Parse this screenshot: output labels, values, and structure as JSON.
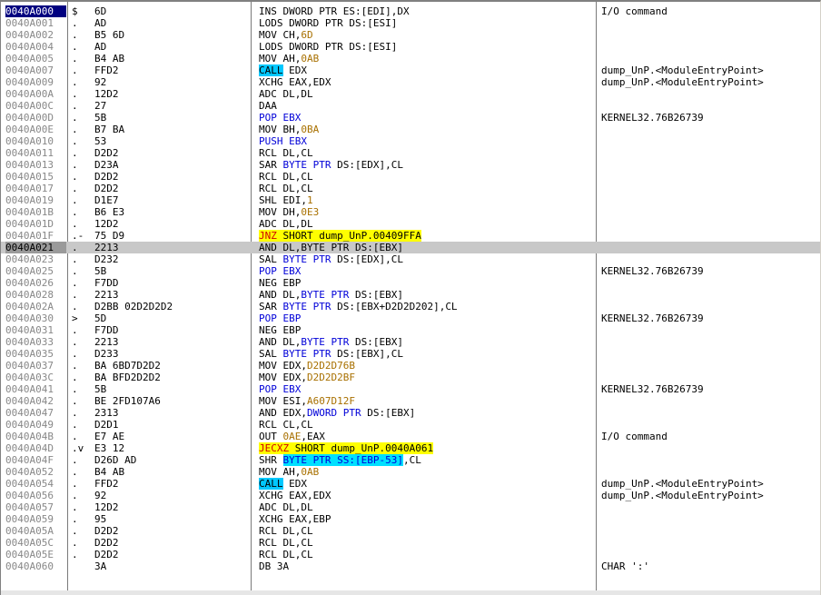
{
  "rows": [
    {
      "addr": "0040A000",
      "mark": "$",
      "hex": "6D",
      "asm": [
        {
          "t": "INS DWORD PTR ES:[EDI],DX",
          "c": "p"
        }
      ],
      "cmt": "I/O command",
      "first": true
    },
    {
      "addr": "0040A001",
      "mark": ".",
      "hex": "AD",
      "asm": [
        {
          "t": "LODS DWORD PTR DS:[ESI]",
          "c": "p"
        }
      ],
      "cmt": ""
    },
    {
      "addr": "0040A002",
      "mark": ".",
      "hex": "B5 6D",
      "asm": [
        {
          "t": "MOV CH,",
          "c": "p"
        },
        {
          "t": "6D",
          "c": "n"
        }
      ],
      "cmt": ""
    },
    {
      "addr": "0040A004",
      "mark": ".",
      "hex": "AD",
      "asm": [
        {
          "t": "LODS DWORD PTR DS:[ESI]",
          "c": "p"
        }
      ],
      "cmt": ""
    },
    {
      "addr": "0040A005",
      "mark": ".",
      "hex": "B4 AB",
      "asm": [
        {
          "t": "MOV AH,",
          "c": "p"
        },
        {
          "t": "0AB",
          "c": "n"
        }
      ],
      "cmt": ""
    },
    {
      "addr": "0040A007",
      "mark": ".",
      "hex": "FFD2",
      "asm": [
        {
          "t": "CALL",
          "c": "call"
        },
        {
          "t": " EDX",
          "c": "p"
        }
      ],
      "cmt": "dump_UnP.<ModuleEntryPoint>"
    },
    {
      "addr": "0040A009",
      "mark": ".",
      "hex": "92",
      "asm": [
        {
          "t": "XCHG EAX,EDX",
          "c": "p"
        }
      ],
      "cmt": "dump_UnP.<ModuleEntryPoint>"
    },
    {
      "addr": "0040A00A",
      "mark": ".",
      "hex": "12D2",
      "asm": [
        {
          "t": "ADC DL,DL",
          "c": "p"
        }
      ],
      "cmt": ""
    },
    {
      "addr": "0040A00C",
      "mark": ".",
      "hex": "27",
      "asm": [
        {
          "t": "DAA",
          "c": "p"
        }
      ],
      "cmt": ""
    },
    {
      "addr": "0040A00D",
      "mark": ".",
      "hex": "5B",
      "asm": [
        {
          "t": "POP EBX",
          "c": "b"
        }
      ],
      "cmt": "KERNEL32.76B26739"
    },
    {
      "addr": "0040A00E",
      "mark": ".",
      "hex": "B7 BA",
      "asm": [
        {
          "t": "MOV BH,",
          "c": "p"
        },
        {
          "t": "0BA",
          "c": "n"
        }
      ],
      "cmt": ""
    },
    {
      "addr": "0040A010",
      "mark": ".",
      "hex": "53",
      "asm": [
        {
          "t": "PUSH EBX",
          "c": "b"
        }
      ],
      "cmt": ""
    },
    {
      "addr": "0040A011",
      "mark": ".",
      "hex": "D2D2",
      "asm": [
        {
          "t": "RCL DL,CL",
          "c": "p"
        }
      ],
      "cmt": ""
    },
    {
      "addr": "0040A013",
      "mark": ".",
      "hex": "D23A",
      "asm": [
        {
          "t": "SAR ",
          "c": "p"
        },
        {
          "t": "BYTE PTR",
          "c": "b"
        },
        {
          "t": " DS:[EDX],CL",
          "c": "p"
        }
      ],
      "cmt": ""
    },
    {
      "addr": "0040A015",
      "mark": ".",
      "hex": "D2D2",
      "asm": [
        {
          "t": "RCL DL,CL",
          "c": "p"
        }
      ],
      "cmt": ""
    },
    {
      "addr": "0040A017",
      "mark": ".",
      "hex": "D2D2",
      "asm": [
        {
          "t": "RCL DL,CL",
          "c": "p"
        }
      ],
      "cmt": ""
    },
    {
      "addr": "0040A019",
      "mark": ".",
      "hex": "D1E7",
      "asm": [
        {
          "t": "SHL EDI,",
          "c": "p"
        },
        {
          "t": "1",
          "c": "n"
        }
      ],
      "cmt": ""
    },
    {
      "addr": "0040A01B",
      "mark": ".",
      "hex": "B6 E3",
      "asm": [
        {
          "t": "MOV DH,",
          "c": "p"
        },
        {
          "t": "0E3",
          "c": "n"
        }
      ],
      "cmt": ""
    },
    {
      "addr": "0040A01D",
      "mark": ".",
      "hex": "12D2",
      "asm": [
        {
          "t": "ADC DL,DL",
          "c": "p"
        }
      ],
      "cmt": ""
    },
    {
      "addr": "0040A01F",
      "mark": ".-",
      "hex": "75 D9",
      "asm": [
        {
          "t": "JNZ",
          "c": "jmp"
        },
        {
          "t": " SHORT dump_UnP.00409FFA",
          "c": "jt"
        }
      ],
      "cmt": ""
    },
    {
      "addr": "0040A021",
      "mark": ".",
      "hex": "2213",
      "asm": [
        {
          "t": "AND DL,BYTE PTR DS:[EBX]",
          "c": "p"
        }
      ],
      "cmt": "",
      "sel": true
    },
    {
      "addr": "0040A023",
      "mark": ".",
      "hex": "D232",
      "asm": [
        {
          "t": "SAL ",
          "c": "p"
        },
        {
          "t": "BYTE PTR",
          "c": "b"
        },
        {
          "t": " DS:[EDX],CL",
          "c": "p"
        }
      ],
      "cmt": ""
    },
    {
      "addr": "0040A025",
      "mark": ".",
      "hex": "5B",
      "asm": [
        {
          "t": "POP EBX",
          "c": "b"
        }
      ],
      "cmt": "KERNEL32.76B26739"
    },
    {
      "addr": "0040A026",
      "mark": ".",
      "hex": "F7DD",
      "asm": [
        {
          "t": "NEG EBP",
          "c": "p"
        }
      ],
      "cmt": ""
    },
    {
      "addr": "0040A028",
      "mark": ".",
      "hex": "2213",
      "asm": [
        {
          "t": "AND DL,",
          "c": "p"
        },
        {
          "t": "BYTE PTR",
          "c": "b"
        },
        {
          "t": " DS:[EBX]",
          "c": "p"
        }
      ],
      "cmt": ""
    },
    {
      "addr": "0040A02A",
      "mark": ".",
      "hex": "D2BB 02D2D2D2",
      "asm": [
        {
          "t": "SAR ",
          "c": "p"
        },
        {
          "t": "BYTE PTR",
          "c": "b"
        },
        {
          "t": " DS:[EBX+D2D2D202],CL",
          "c": "p"
        }
      ],
      "cmt": ""
    },
    {
      "addr": "0040A030",
      "mark": ">",
      "hex": "5D",
      "asm": [
        {
          "t": "POP EBP",
          "c": "b"
        }
      ],
      "cmt": "KERNEL32.76B26739"
    },
    {
      "addr": "0040A031",
      "mark": ".",
      "hex": "F7DD",
      "asm": [
        {
          "t": "NEG EBP",
          "c": "p"
        }
      ],
      "cmt": ""
    },
    {
      "addr": "0040A033",
      "mark": ".",
      "hex": "2213",
      "asm": [
        {
          "t": "AND DL,",
          "c": "p"
        },
        {
          "t": "BYTE PTR",
          "c": "b"
        },
        {
          "t": " DS:[EBX]",
          "c": "p"
        }
      ],
      "cmt": ""
    },
    {
      "addr": "0040A035",
      "mark": ".",
      "hex": "D233",
      "asm": [
        {
          "t": "SAL ",
          "c": "p"
        },
        {
          "t": "BYTE PTR",
          "c": "b"
        },
        {
          "t": " DS:[EBX],CL",
          "c": "p"
        }
      ],
      "cmt": ""
    },
    {
      "addr": "0040A037",
      "mark": ".",
      "hex": "BA 6BD7D2D2",
      "asm": [
        {
          "t": "MOV EDX,",
          "c": "p"
        },
        {
          "t": "D2D2D76B",
          "c": "n"
        }
      ],
      "cmt": ""
    },
    {
      "addr": "0040A03C",
      "mark": ".",
      "hex": "BA BFD2D2D2",
      "asm": [
        {
          "t": "MOV EDX,",
          "c": "p"
        },
        {
          "t": "D2D2D2BF",
          "c": "n"
        }
      ],
      "cmt": ""
    },
    {
      "addr": "0040A041",
      "mark": ".",
      "hex": "5B",
      "asm": [
        {
          "t": "POP EBX",
          "c": "b"
        }
      ],
      "cmt": "KERNEL32.76B26739"
    },
    {
      "addr": "0040A042",
      "mark": ".",
      "hex": "BE 2FD107A6",
      "asm": [
        {
          "t": "MOV ESI,",
          "c": "p"
        },
        {
          "t": "A607D12F",
          "c": "n"
        }
      ],
      "cmt": ""
    },
    {
      "addr": "0040A047",
      "mark": ".",
      "hex": "2313",
      "asm": [
        {
          "t": "AND EDX,",
          "c": "p"
        },
        {
          "t": "DWORD PTR",
          "c": "b"
        },
        {
          "t": " DS:[EBX]",
          "c": "p"
        }
      ],
      "cmt": ""
    },
    {
      "addr": "0040A049",
      "mark": ".",
      "hex": "D2D1",
      "asm": [
        {
          "t": "RCL CL,CL",
          "c": "p"
        }
      ],
      "cmt": ""
    },
    {
      "addr": "0040A04B",
      "mark": ".",
      "hex": "E7 AE",
      "asm": [
        {
          "t": "OUT ",
          "c": "p"
        },
        {
          "t": "0AE",
          "c": "n"
        },
        {
          "t": ",EAX",
          "c": "p"
        }
      ],
      "cmt": "I/O command"
    },
    {
      "addr": "0040A04D",
      "mark": ".v",
      "hex": "E3 12",
      "asm": [
        {
          "t": "JECXZ",
          "c": "jmp"
        },
        {
          "t": " SHORT dump_UnP.0040A061",
          "c": "jt"
        }
      ],
      "cmt": ""
    },
    {
      "addr": "0040A04F",
      "mark": ".",
      "hex": "D26D AD",
      "asm": [
        {
          "t": "SHR ",
          "c": "p"
        },
        {
          "t": "BYTE PTR SS:[EBP-53]",
          "c": "cy"
        },
        {
          "t": ",CL",
          "c": "p"
        }
      ],
      "cmt": ""
    },
    {
      "addr": "0040A052",
      "mark": ".",
      "hex": "B4 AB",
      "asm": [
        {
          "t": "MOV AH,",
          "c": "p"
        },
        {
          "t": "0AB",
          "c": "n"
        }
      ],
      "cmt": ""
    },
    {
      "addr": "0040A054",
      "mark": ".",
      "hex": "FFD2",
      "asm": [
        {
          "t": "CALL",
          "c": "call"
        },
        {
          "t": " EDX",
          "c": "p"
        }
      ],
      "cmt": "dump_UnP.<ModuleEntryPoint>"
    },
    {
      "addr": "0040A056",
      "mark": ".",
      "hex": "92",
      "asm": [
        {
          "t": "XCHG EAX,EDX",
          "c": "p"
        }
      ],
      "cmt": "dump_UnP.<ModuleEntryPoint>"
    },
    {
      "addr": "0040A057",
      "mark": ".",
      "hex": "12D2",
      "asm": [
        {
          "t": "ADC DL,DL",
          "c": "p"
        }
      ],
      "cmt": ""
    },
    {
      "addr": "0040A059",
      "mark": ".",
      "hex": "95",
      "asm": [
        {
          "t": "XCHG EAX,EBP",
          "c": "p"
        }
      ],
      "cmt": ""
    },
    {
      "addr": "0040A05A",
      "mark": ".",
      "hex": "D2D2",
      "asm": [
        {
          "t": "RCL DL,CL",
          "c": "p"
        }
      ],
      "cmt": ""
    },
    {
      "addr": "0040A05C",
      "mark": ".",
      "hex": "D2D2",
      "asm": [
        {
          "t": "RCL DL,CL",
          "c": "p"
        }
      ],
      "cmt": ""
    },
    {
      "addr": "0040A05E",
      "mark": ".",
      "hex": "D2D2",
      "asm": [
        {
          "t": "RCL DL,CL",
          "c": "p"
        }
      ],
      "cmt": ""
    },
    {
      "addr": "0040A060",
      "mark": "",
      "hex": "3A",
      "asm": [
        {
          "t": "DB 3A",
          "c": "p"
        }
      ],
      "cmt": "CHAR ':'"
    }
  ],
  "colors": {
    "address": "#888888",
    "selected": "#c8c8c8",
    "first_addr_bg": "#000080",
    "keyword_blue": "#0000d8",
    "immediate": "#a87000",
    "jump_highlight": "#ffff00",
    "call_highlight": "#00c8ff"
  }
}
